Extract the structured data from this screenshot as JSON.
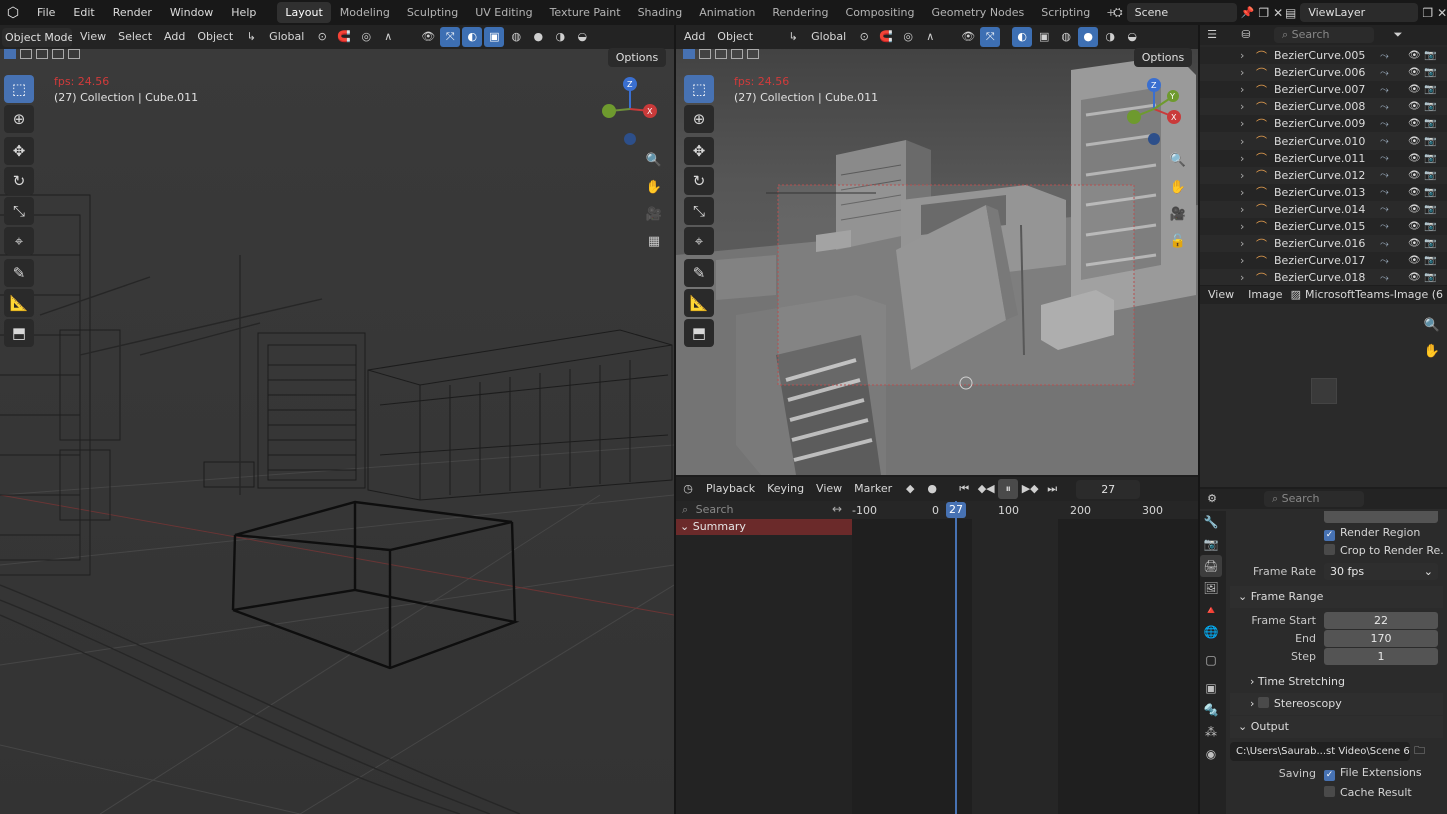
{
  "topbar": {
    "menus": [
      "File",
      "Edit",
      "Render",
      "Window",
      "Help"
    ],
    "workspaces": [
      "Layout",
      "Modeling",
      "Sculpting",
      "UV Editing",
      "Texture Paint",
      "Shading",
      "Animation",
      "Rendering",
      "Compositing",
      "Geometry Nodes",
      "Scripting"
    ],
    "active_workspace": "Layout",
    "add_tab": "+",
    "scene": "Scene",
    "view_layer": "ViewLayer"
  },
  "left_viewport": {
    "mode": "Object Mode",
    "menus": [
      "View",
      "Select",
      "Add",
      "Object"
    ],
    "orientation": "Global",
    "options": "Options",
    "fps": "fps: 24.56",
    "info": "(27) Collection | Cube.011"
  },
  "right_viewport": {
    "menus": [
      "Add",
      "Object"
    ],
    "orientation": "Global",
    "options": "Options",
    "fps": "fps: 24.56",
    "info": "(27) Collection | Cube.011"
  },
  "timeline": {
    "menus": [
      "Playback",
      "Keying",
      "View",
      "Marker"
    ],
    "current_frame": "27",
    "search_placeholder": "Search",
    "ruler": [
      "-100",
      "0",
      "27",
      "100",
      "200",
      "300"
    ],
    "summary": "Summary"
  },
  "outliner": {
    "search_placeholder": "Search",
    "items": [
      "BezierCurve.005",
      "BezierCurve.006",
      "BezierCurve.007",
      "BezierCurve.008",
      "BezierCurve.009",
      "BezierCurve.010",
      "BezierCurve.011",
      "BezierCurve.012",
      "BezierCurve.013",
      "BezierCurve.014",
      "BezierCurve.015",
      "BezierCurve.016",
      "BezierCurve.017",
      "BezierCurve.018"
    ]
  },
  "image_editor": {
    "menus": [
      "View",
      "Image"
    ],
    "image_name": "MicrosoftTeams-Image (6"
  },
  "properties": {
    "search_placeholder": "Search",
    "render_region": "Render Region",
    "crop_region": "Crop to Render Re...",
    "frame_rate_label": "Frame Rate",
    "frame_rate": "30 fps",
    "frame_range": "Frame Range",
    "frame_start_label": "Frame Start",
    "frame_start": "22",
    "end_label": "End",
    "end": "170",
    "step_label": "Step",
    "step": "1",
    "time_stretching": "Time Stretching",
    "stereoscopy": "Stereoscopy",
    "output": "Output",
    "output_path": "C:\\Users\\Saurab...st Video\\Scene 6\\",
    "saving_label": "Saving",
    "file_extensions": "File Extensions",
    "cache_result": "Cache Result"
  },
  "colors": {
    "accent": "#4772b3",
    "fps_red": "#d23b3b",
    "summary_bg": "#6b2a2a"
  }
}
